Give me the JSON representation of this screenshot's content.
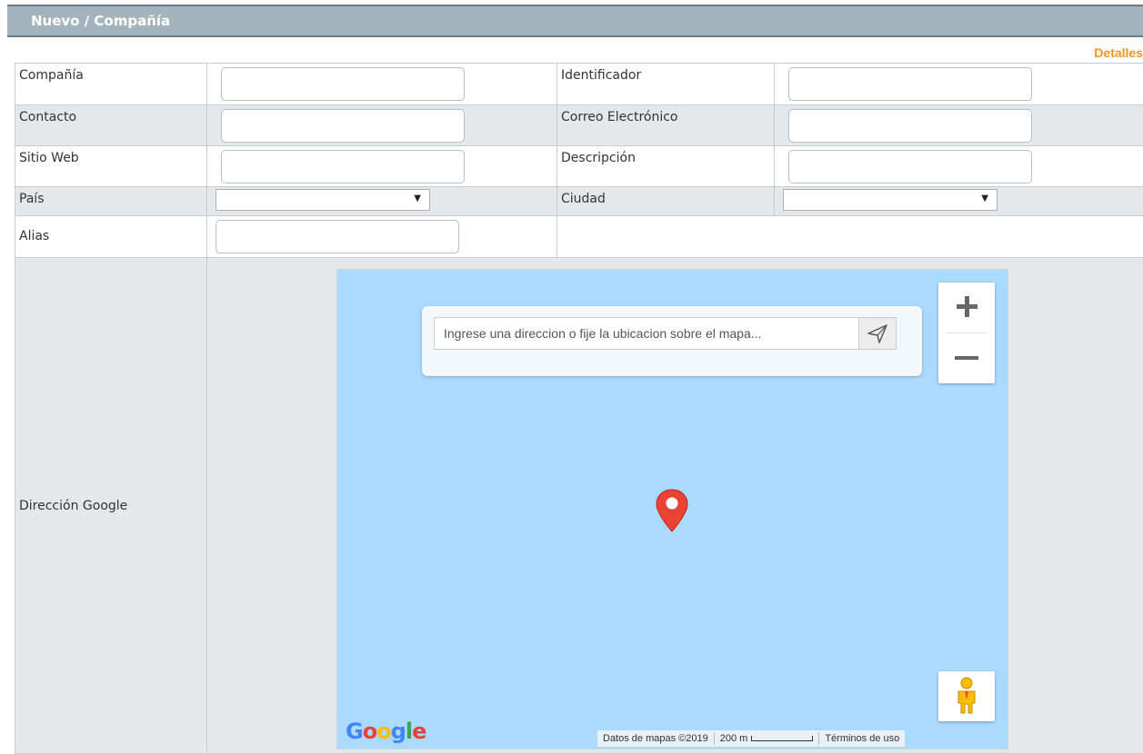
{
  "header": {
    "title": "Nuevo / Compañía",
    "details_link": "Detalles"
  },
  "form": {
    "company_label": "Compañía",
    "identifier_label": "Identificador",
    "contact_label": "Contacto",
    "email_label": "Correo Electrónico",
    "website_label": "Sitio Web",
    "description_label": "Descripción",
    "country_label": "País",
    "country_value": "",
    "city_label": "Ciudad",
    "city_value": "",
    "alias_label": "Alias",
    "map_label": "Dirección Google"
  },
  "map": {
    "search_placeholder": "Ingrese una direccion o fije la ubicacion sobre el mapa...",
    "logo": "Google",
    "attribution": "Datos de mapas ©2019",
    "scale": "200 m",
    "terms": "Términos de uso",
    "colors": {
      "water": "#aadaff",
      "pin": "#ea4335"
    }
  }
}
